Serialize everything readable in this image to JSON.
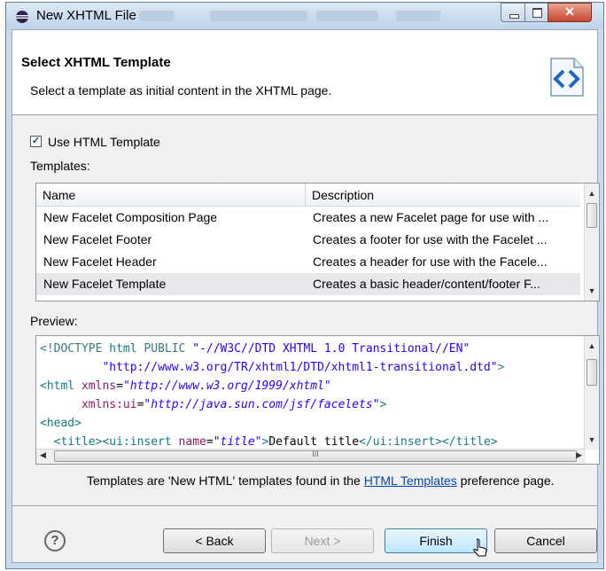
{
  "window": {
    "title": "New XHTML File"
  },
  "header": {
    "title": "Select XHTML Template",
    "description": "Select a template as initial content in the XHTML page."
  },
  "use_template": {
    "label": "Use HTML Template",
    "checked": true
  },
  "templates": {
    "label": "Templates:",
    "columns": [
      "Name",
      "Description"
    ],
    "rows": [
      {
        "name": "New Facelet Composition Page",
        "description": "Creates a new Facelet page for use with ..."
      },
      {
        "name": "New Facelet Footer",
        "description": "Creates a footer for use with the Facelet ..."
      },
      {
        "name": "New Facelet Header",
        "description": "Creates a header for use with the Facele..."
      },
      {
        "name": "New Facelet Template",
        "description": "Creates a basic header/content/footer F..."
      }
    ],
    "selected_index": 3
  },
  "preview": {
    "label": "Preview:",
    "scroll_marker": "III"
  },
  "note": {
    "prefix": "Templates are 'New HTML' templates found in the ",
    "link": "HTML Templates",
    "suffix": " preference page."
  },
  "buttons": {
    "help": "?",
    "back": "< Back",
    "next": "Next >",
    "finish": "Finish",
    "cancel": "Cancel"
  },
  "icons": {
    "title": "eclipse-icon",
    "header": "xhtml-file-icon",
    "help": "help-icon"
  },
  "colors": {
    "link": "#0645ad",
    "tag": "#117a87",
    "attribute": "#8a1a64",
    "string": "#2a00ff"
  }
}
